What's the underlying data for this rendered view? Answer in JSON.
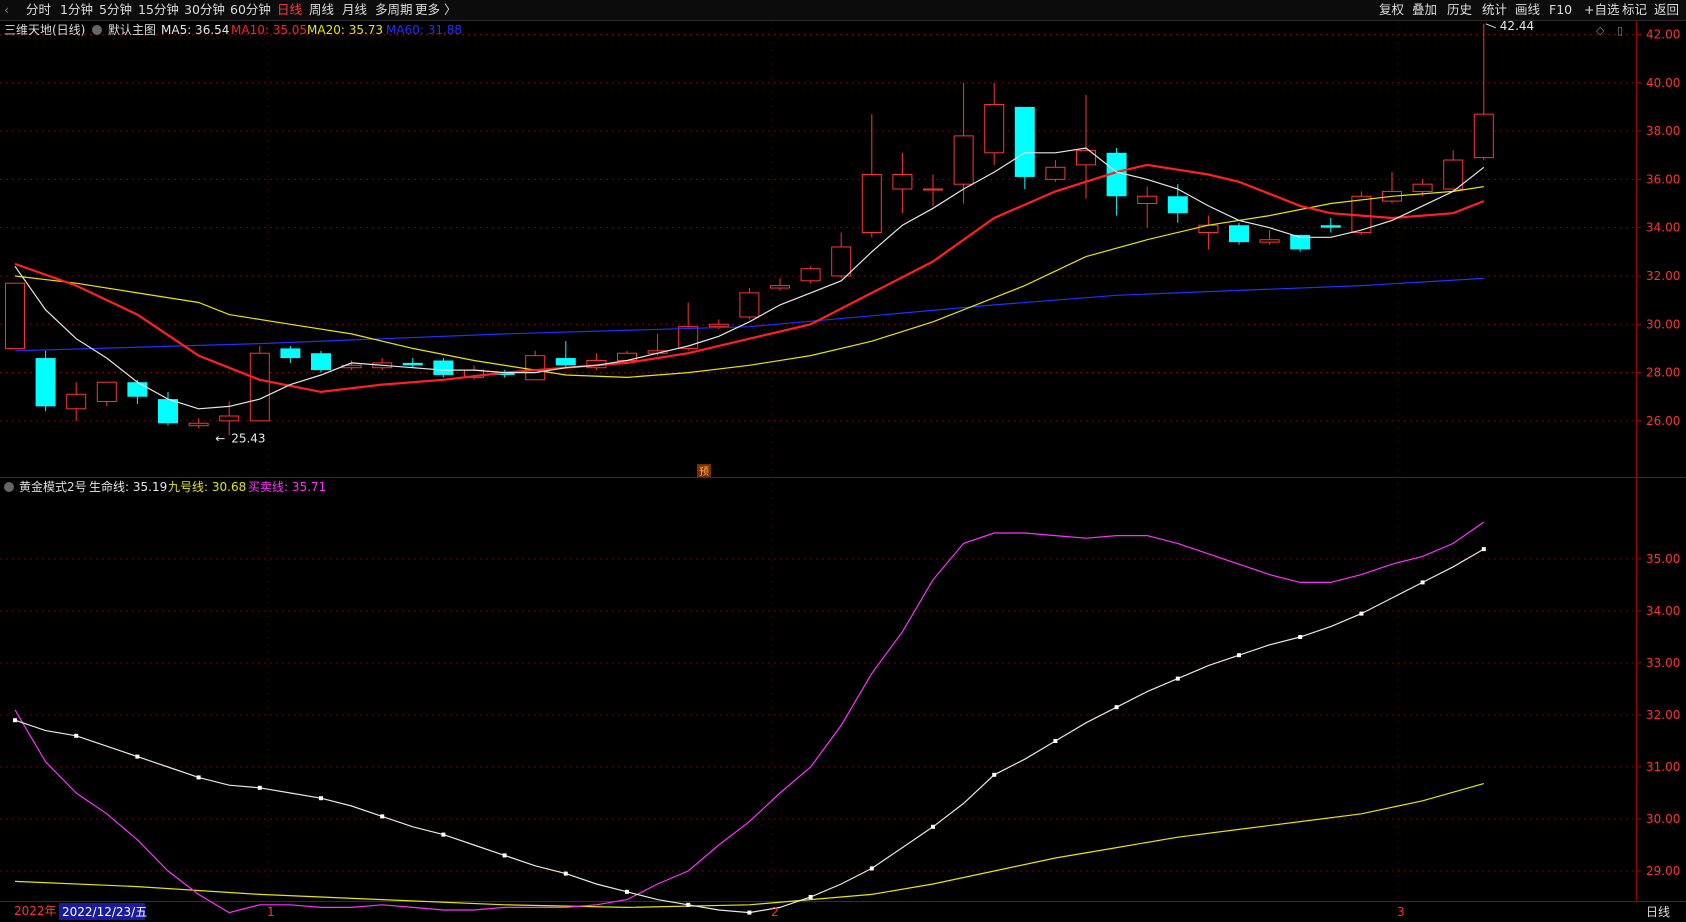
{
  "toolbar": {
    "left_items": [
      "分时",
      "1分钟",
      "5分钟",
      "15分钟",
      "30分钟",
      "60分钟",
      "日线",
      "周线",
      "月线",
      "多周期",
      "更多 〉"
    ],
    "active_item": "日线",
    "right_items": [
      "复权",
      "叠加",
      "历史",
      "统计",
      "画线",
      "F10",
      "+自选",
      "标记",
      "返回"
    ]
  },
  "main_panel": {
    "stock_title": "三维天地(日线)",
    "template": "默认主图",
    "ma_legend": [
      {
        "label": "MA5: 36.54",
        "color": "#e6e6e6"
      },
      {
        "label": "MA10: 35.05",
        "color": "#ff2020"
      },
      {
        "label": "MA20: 35.73",
        "color": "#e6e600"
      },
      {
        "label": "MA60: 31.88",
        "color": "#2030ff"
      }
    ],
    "max_label": "42.44",
    "min_label": "25.43",
    "forecast_badge": "预",
    "y_ticks": [
      "42.00",
      "40.00",
      "38.00",
      "36.00",
      "34.00",
      "32.00",
      "30.00",
      "28.00",
      "26.00"
    ]
  },
  "sub_panel": {
    "indicator_name": "黄金模式2号",
    "legend": [
      {
        "label": "生命线: 35.19",
        "color": "#e6e6e6"
      },
      {
        "label": "九号线: 30.68",
        "color": "#e6e600"
      },
      {
        "label": "买卖线: 35.71",
        "color": "#ff30ff"
      }
    ],
    "y_ticks": [
      "35.00",
      "34.00",
      "33.00",
      "32.00",
      "31.00",
      "30.00",
      "29.00"
    ]
  },
  "date_axis": {
    "year": "2022年",
    "cursor_date": "2022/12/23/五",
    "month_markers": [
      "1",
      "2",
      "3"
    ],
    "period_button": "日线"
  },
  "colors": {
    "up": "#ff3232",
    "down": "#00ffff",
    "ma5": "#e6e6e6",
    "ma10": "#ff2020",
    "ma20": "#e6e600",
    "ma60": "#2030ff",
    "life_line": "#e6e6e6",
    "nine_line": "#e6e600",
    "trade_line": "#ff30ff",
    "grid": "#7a0000"
  },
  "chart_data": {
    "type": "candlestick",
    "candles": [
      {
        "o": 29.0,
        "c": 31.7,
        "h": 31.7,
        "l": 29.0
      },
      {
        "o": 28.6,
        "c": 26.6,
        "h": 28.9,
        "l": 26.4
      },
      {
        "o": 26.5,
        "c": 27.1,
        "h": 27.6,
        "l": 26.0
      },
      {
        "o": 26.8,
        "c": 27.6,
        "h": 27.6,
        "l": 26.6
      },
      {
        "o": 27.6,
        "c": 27.0,
        "h": 27.7,
        "l": 26.7
      },
      {
        "o": 26.9,
        "c": 25.9,
        "h": 27.2,
        "l": 25.8
      },
      {
        "o": 25.8,
        "c": 25.9,
        "h": 26.1,
        "l": 25.7
      },
      {
        "o": 26.0,
        "c": 26.2,
        "h": 26.8,
        "l": 25.4
      },
      {
        "o": 26.0,
        "c": 28.8,
        "h": 29.1,
        "l": 26.0
      },
      {
        "o": 29.0,
        "c": 28.6,
        "h": 29.1,
        "l": 28.4
      },
      {
        "o": 28.8,
        "c": 28.1,
        "h": 28.9,
        "l": 28.0
      },
      {
        "o": 28.2,
        "c": 28.3,
        "h": 28.5,
        "l": 28.1
      },
      {
        "o": 28.2,
        "c": 28.4,
        "h": 28.6,
        "l": 28.1
      },
      {
        "o": 28.4,
        "c": 28.3,
        "h": 28.6,
        "l": 28.2
      },
      {
        "o": 28.5,
        "c": 27.9,
        "h": 28.6,
        "l": 27.8
      },
      {
        "o": 27.8,
        "c": 28.1,
        "h": 28.3,
        "l": 27.7
      },
      {
        "o": 28.0,
        "c": 27.9,
        "h": 28.1,
        "l": 27.8
      },
      {
        "o": 27.7,
        "c": 28.7,
        "h": 28.9,
        "l": 27.7
      },
      {
        "o": 28.6,
        "c": 28.3,
        "h": 29.3,
        "l": 28.2
      },
      {
        "o": 28.2,
        "c": 28.5,
        "h": 28.8,
        "l": 28.1
      },
      {
        "o": 28.5,
        "c": 28.8,
        "h": 28.9,
        "l": 28.4
      },
      {
        "o": 28.8,
        "c": 28.9,
        "h": 29.6,
        "l": 28.7
      },
      {
        "o": 29.0,
        "c": 29.9,
        "h": 30.9,
        "l": 28.9
      },
      {
        "o": 29.9,
        "c": 30.0,
        "h": 30.2,
        "l": 29.8
      },
      {
        "o": 30.3,
        "c": 31.3,
        "h": 31.5,
        "l": 30.2
      },
      {
        "o": 31.5,
        "c": 31.6,
        "h": 31.9,
        "l": 31.4
      },
      {
        "o": 31.8,
        "c": 32.3,
        "h": 32.4,
        "l": 31.7
      },
      {
        "o": 32.0,
        "c": 33.2,
        "h": 33.8,
        "l": 31.9
      },
      {
        "o": 33.8,
        "c": 36.2,
        "h": 38.7,
        "l": 33.6
      },
      {
        "o": 35.6,
        "c": 36.2,
        "h": 37.1,
        "l": 34.6
      },
      {
        "o": 35.6,
        "c": 35.6,
        "h": 36.2,
        "l": 34.9
      },
      {
        "o": 35.8,
        "c": 37.8,
        "h": 40.0,
        "l": 35.0
      },
      {
        "o": 37.1,
        "c": 39.1,
        "h": 40.0,
        "l": 36.6
      },
      {
        "o": 39.0,
        "c": 36.1,
        "h": 39.0,
        "l": 35.6
      },
      {
        "o": 36.0,
        "c": 36.5,
        "h": 36.8,
        "l": 35.9
      },
      {
        "o": 36.6,
        "c": 37.2,
        "h": 39.5,
        "l": 35.2
      },
      {
        "o": 37.1,
        "c": 35.3,
        "h": 37.3,
        "l": 34.5
      },
      {
        "o": 35.0,
        "c": 35.3,
        "h": 35.7,
        "l": 34.0
      },
      {
        "o": 35.3,
        "c": 34.6,
        "h": 35.8,
        "l": 34.2
      },
      {
        "o": 33.8,
        "c": 34.1,
        "h": 34.5,
        "l": 33.1
      },
      {
        "o": 34.1,
        "c": 33.4,
        "h": 34.2,
        "l": 33.3
      },
      {
        "o": 33.4,
        "c": 33.5,
        "h": 33.9,
        "l": 33.3
      },
      {
        "o": 33.7,
        "c": 33.1,
        "h": 33.7,
        "l": 33.0
      },
      {
        "o": 34.1,
        "c": 34.0,
        "h": 34.4,
        "l": 33.8
      },
      {
        "o": 33.8,
        "c": 35.3,
        "h": 35.5,
        "l": 33.7
      },
      {
        "o": 35.1,
        "c": 35.5,
        "h": 36.3,
        "l": 35.0
      },
      {
        "o": 35.5,
        "c": 35.8,
        "h": 36.0,
        "l": 35.3
      },
      {
        "o": 35.6,
        "c": 36.8,
        "h": 37.2,
        "l": 35.5
      },
      {
        "o": 36.9,
        "c": 38.7,
        "h": 42.44,
        "l": 36.8
      }
    ],
    "ma5": [
      [
        0,
        32.4
      ],
      [
        1,
        30.6
      ],
      [
        2,
        29.4
      ],
      [
        3,
        28.6
      ],
      [
        4,
        27.6
      ],
      [
        5,
        26.9
      ],
      [
        6,
        26.5
      ],
      [
        7,
        26.6
      ],
      [
        8,
        26.9
      ],
      [
        9,
        27.5
      ],
      [
        10,
        27.9
      ],
      [
        11,
        28.4
      ],
      [
        12,
        28.3
      ],
      [
        13,
        28.2
      ],
      [
        14,
        28.1
      ],
      [
        15,
        28.1
      ],
      [
        16,
        28.0
      ],
      [
        17,
        28.0
      ],
      [
        18,
        28.2
      ],
      [
        19,
        28.3
      ],
      [
        20,
        28.5
      ],
      [
        21,
        28.8
      ],
      [
        22,
        29.1
      ],
      [
        23,
        29.5
      ],
      [
        24,
        30.1
      ],
      [
        25,
        30.8
      ],
      [
        26,
        31.3
      ],
      [
        27,
        31.8
      ],
      [
        28,
        33.0
      ],
      [
        29,
        34.1
      ],
      [
        30,
        34.8
      ],
      [
        31,
        35.6
      ],
      [
        32,
        36.3
      ],
      [
        33,
        37.1
      ],
      [
        34,
        37.1
      ],
      [
        35,
        37.3
      ],
      [
        36,
        36.3
      ],
      [
        37,
        36.0
      ],
      [
        38,
        35.6
      ],
      [
        39,
        34.9
      ],
      [
        40,
        34.3
      ],
      [
        41,
        34.0
      ],
      [
        42,
        33.6
      ],
      [
        43,
        33.6
      ],
      [
        44,
        33.9
      ],
      [
        45,
        34.3
      ],
      [
        46,
        34.9
      ],
      [
        47,
        35.5
      ],
      [
        48,
        36.5
      ]
    ],
    "ma10": [
      [
        0,
        32.5
      ],
      [
        2,
        31.6
      ],
      [
        4,
        30.4
      ],
      [
        6,
        28.7
      ],
      [
        8,
        27.7
      ],
      [
        10,
        27.2
      ],
      [
        12,
        27.5
      ],
      [
        14,
        27.7
      ],
      [
        16,
        28.0
      ],
      [
        18,
        28.2
      ],
      [
        20,
        28.4
      ],
      [
        22,
        28.8
      ],
      [
        24,
        29.4
      ],
      [
        26,
        30.0
      ],
      [
        28,
        31.3
      ],
      [
        30,
        32.6
      ],
      [
        32,
        34.4
      ],
      [
        34,
        35.5
      ],
      [
        36,
        36.3
      ],
      [
        37,
        36.6
      ],
      [
        38,
        36.4
      ],
      [
        39,
        36.2
      ],
      [
        40,
        35.9
      ],
      [
        41,
        35.4
      ],
      [
        42,
        34.9
      ],
      [
        43,
        34.6
      ],
      [
        44,
        34.5
      ],
      [
        45,
        34.4
      ],
      [
        46,
        34.5
      ],
      [
        47,
        34.6
      ],
      [
        48,
        35.1
      ]
    ],
    "ma20": [
      [
        0,
        32.0
      ],
      [
        2,
        31.7
      ],
      [
        4,
        31.3
      ],
      [
        6,
        30.9
      ],
      [
        7,
        30.4
      ],
      [
        9,
        30.0
      ],
      [
        11,
        29.6
      ],
      [
        13,
        29.0
      ],
      [
        15,
        28.5
      ],
      [
        17,
        28.1
      ],
      [
        18,
        27.9
      ],
      [
        20,
        27.8
      ],
      [
        22,
        28.0
      ],
      [
        24,
        28.3
      ],
      [
        26,
        28.7
      ],
      [
        28,
        29.3
      ],
      [
        30,
        30.1
      ],
      [
        32,
        31.1
      ],
      [
        33,
        31.6
      ],
      [
        35,
        32.8
      ],
      [
        37,
        33.5
      ],
      [
        39,
        34.1
      ],
      [
        41,
        34.5
      ],
      [
        43,
        35.0
      ],
      [
        45,
        35.3
      ],
      [
        47,
        35.5
      ],
      [
        48,
        35.7
      ]
    ],
    "ma60": [
      [
        0,
        28.9
      ],
      [
        8,
        29.2
      ],
      [
        16,
        29.6
      ],
      [
        24,
        29.9
      ],
      [
        32,
        30.8
      ],
      [
        36,
        31.2
      ],
      [
        40,
        31.4
      ],
      [
        44,
        31.6
      ],
      [
        48,
        31.9
      ]
    ],
    "life_line": [
      [
        0,
        31.9
      ],
      [
        1,
        31.7
      ],
      [
        2,
        31.6
      ],
      [
        3,
        31.4
      ],
      [
        4,
        31.2
      ],
      [
        5,
        31.0
      ],
      [
        6,
        30.8
      ],
      [
        7,
        30.65
      ],
      [
        8,
        30.6
      ],
      [
        9,
        30.5
      ],
      [
        10,
        30.4
      ],
      [
        11,
        30.25
      ],
      [
        12,
        30.05
      ],
      [
        13,
        29.85
      ],
      [
        14,
        29.7
      ],
      [
        15,
        29.5
      ],
      [
        16,
        29.3
      ],
      [
        17,
        29.1
      ],
      [
        18,
        28.95
      ],
      [
        19,
        28.75
      ],
      [
        20,
        28.6
      ],
      [
        21,
        28.45
      ],
      [
        22,
        28.35
      ],
      [
        23,
        28.25
      ],
      [
        24,
        28.2
      ],
      [
        25,
        28.3
      ],
      [
        26,
        28.5
      ],
      [
        27,
        28.75
      ],
      [
        28,
        29.05
      ],
      [
        29,
        29.45
      ],
      [
        30,
        29.85
      ],
      [
        31,
        30.3
      ],
      [
        32,
        30.85
      ],
      [
        33,
        31.15
      ],
      [
        34,
        31.5
      ],
      [
        35,
        31.85
      ],
      [
        36,
        32.15
      ],
      [
        37,
        32.45
      ],
      [
        38,
        32.7
      ],
      [
        39,
        32.95
      ],
      [
        40,
        33.15
      ],
      [
        41,
        33.35
      ],
      [
        42,
        33.5
      ],
      [
        43,
        33.7
      ],
      [
        44,
        33.95
      ],
      [
        45,
        34.25
      ],
      [
        46,
        34.55
      ],
      [
        47,
        34.85
      ],
      [
        48,
        35.19
      ]
    ],
    "nine_line": [
      [
        0,
        28.8
      ],
      [
        4,
        28.7
      ],
      [
        8,
        28.55
      ],
      [
        12,
        28.45
      ],
      [
        16,
        28.35
      ],
      [
        20,
        28.3
      ],
      [
        24,
        28.35
      ],
      [
        28,
        28.55
      ],
      [
        30,
        28.75
      ],
      [
        32,
        29.0
      ],
      [
        34,
        29.25
      ],
      [
        36,
        29.45
      ],
      [
        38,
        29.65
      ],
      [
        40,
        29.8
      ],
      [
        42,
        29.95
      ],
      [
        44,
        30.1
      ],
      [
        46,
        30.35
      ],
      [
        48,
        30.68
      ]
    ],
    "trade_line": [
      [
        0,
        32.1
      ],
      [
        1,
        31.1
      ],
      [
        2,
        30.5
      ],
      [
        3,
        30.1
      ],
      [
        4,
        29.6
      ],
      [
        5,
        29.0
      ],
      [
        6,
        28.55
      ],
      [
        7,
        28.2
      ],
      [
        8,
        28.35
      ],
      [
        9,
        28.35
      ],
      [
        10,
        28.3
      ],
      [
        11,
        28.3
      ],
      [
        12,
        28.35
      ],
      [
        13,
        28.3
      ],
      [
        14,
        28.25
      ],
      [
        15,
        28.25
      ],
      [
        16,
        28.3
      ],
      [
        17,
        28.3
      ],
      [
        18,
        28.3
      ],
      [
        19,
        28.35
      ],
      [
        20,
        28.45
      ],
      [
        21,
        28.75
      ],
      [
        22,
        29.0
      ],
      [
        23,
        29.5
      ],
      [
        24,
        29.95
      ],
      [
        25,
        30.5
      ],
      [
        26,
        31.0
      ],
      [
        27,
        31.8
      ],
      [
        28,
        32.8
      ],
      [
        29,
        33.6
      ],
      [
        30,
        34.6
      ],
      [
        31,
        35.3
      ],
      [
        32,
        35.5
      ],
      [
        33,
        35.5
      ],
      [
        34,
        35.45
      ],
      [
        35,
        35.4
      ],
      [
        36,
        35.45
      ],
      [
        37,
        35.45
      ],
      [
        38,
        35.3
      ],
      [
        39,
        35.1
      ],
      [
        40,
        34.9
      ],
      [
        41,
        34.7
      ],
      [
        42,
        34.55
      ],
      [
        43,
        34.55
      ],
      [
        44,
        34.7
      ],
      [
        45,
        34.9
      ],
      [
        46,
        35.05
      ],
      [
        47,
        35.3
      ],
      [
        48,
        35.71
      ]
    ]
  }
}
